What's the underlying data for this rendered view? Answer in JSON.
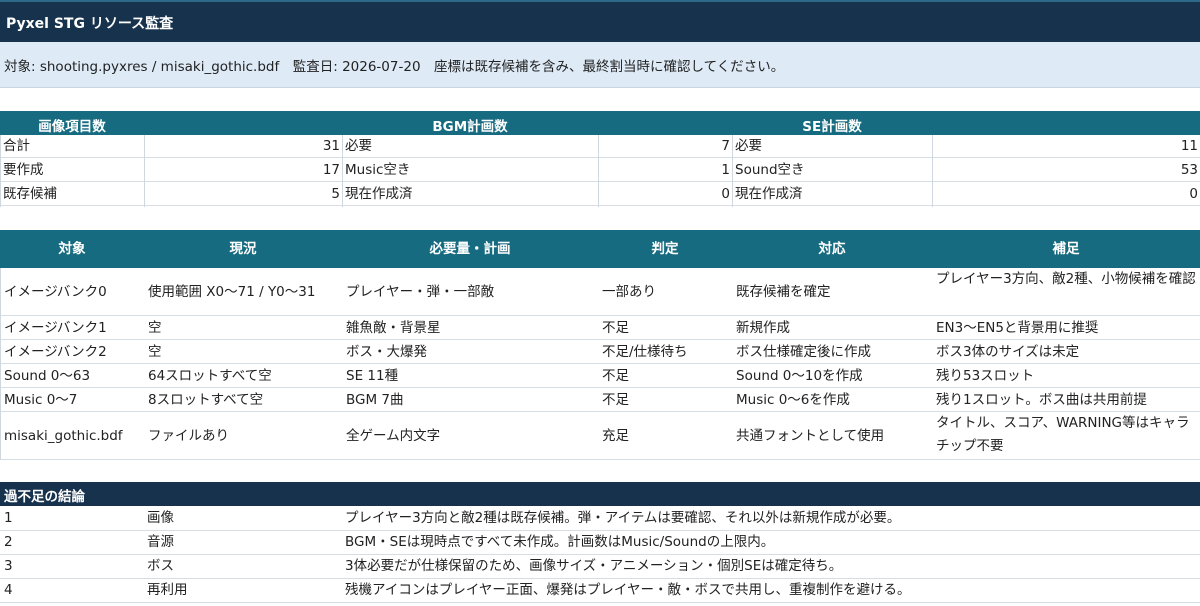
{
  "title": "Pyxel STG リソース監査",
  "meta": "対象: shooting.pyxres / misaki_gothic.bdf　監査日: 2026-07-20　座標は既存候補を含み、最終割当時に確認してください。",
  "summary": {
    "image": {
      "header": "画像項目数",
      "rows": [
        {
          "label": "合計",
          "value": "31"
        },
        {
          "label": "要作成",
          "value": "17"
        },
        {
          "label": "既存候補",
          "value": "5"
        }
      ]
    },
    "bgm": {
      "header": "BGM計画数",
      "rows": [
        {
          "label": "必要",
          "value": "7"
        },
        {
          "label": "Music空き",
          "value": "1"
        },
        {
          "label": "現在作成済",
          "value": "0"
        }
      ]
    },
    "se": {
      "header": "SE計画数",
      "rows": [
        {
          "label": "必要",
          "value": "11"
        },
        {
          "label": "Sound空き",
          "value": "53"
        },
        {
          "label": "現在作成済",
          "value": "0"
        }
      ]
    }
  },
  "table": {
    "headers": [
      "対象",
      "現況",
      "必要量・計画",
      "判定",
      "対応",
      "補足"
    ],
    "rows": [
      [
        "イメージバンク0",
        "使用範囲 X0〜71 / Y0〜31",
        "プレイヤー・弾・一部敵",
        "一部あり",
        "既存候補を確定",
        "プレイヤー3方向、敵2種、小物候補を確認"
      ],
      [
        "イメージバンク1",
        "空",
        "雑魚敵・背景星",
        "不足",
        "新規作成",
        "EN3〜EN5と背景用に推奨"
      ],
      [
        "イメージバンク2",
        "空",
        "ボス・大爆発",
        "不足/仕様待ち",
        "ボス仕様確定後に作成",
        "ボス3体のサイズは未定"
      ],
      [
        "Sound 0〜63",
        "64スロットすべて空",
        "SE 11種",
        "不足",
        "Sound 0〜10を作成",
        "残り53スロット"
      ],
      [
        "Music 0〜7",
        "8スロットすべて空",
        "BGM 7曲",
        "不足",
        "Music 0〜6を作成",
        "残り1スロット。ボス曲は共用前提"
      ],
      [
        "misaki_gothic.bdf",
        "ファイルあり",
        "全ゲーム内文字",
        "充足",
        "共通フォントとして使用",
        "タイトル、スコア、WARNING等はキャラチップ不要"
      ]
    ]
  },
  "conclusion": {
    "header": "過不足の結論",
    "rows": [
      {
        "no": "1",
        "category": "画像",
        "text": "プレイヤー3方向と敵2種は既存候補。弾・アイテムは要確認、それ以外は新規作成が必要。"
      },
      {
        "no": "2",
        "category": "音源",
        "text": "BGM・SEは現時点ですべて未作成。計画数はMusic/Soundの上限内。"
      },
      {
        "no": "3",
        "category": "ボス",
        "text": "3体必要だが仕様保留のため、画像サイズ・アニメーション・個別SEは確定待ち。"
      },
      {
        "no": "4",
        "category": "再利用",
        "text": "残機アイコンはプレイヤー正面、爆発はプレイヤー・敵・ボスで共用し、重複制作を避ける。"
      }
    ]
  },
  "colors": {
    "title_bg": "#17324d",
    "header_bg": "#176b80",
    "meta_bg": "#deebf7"
  }
}
